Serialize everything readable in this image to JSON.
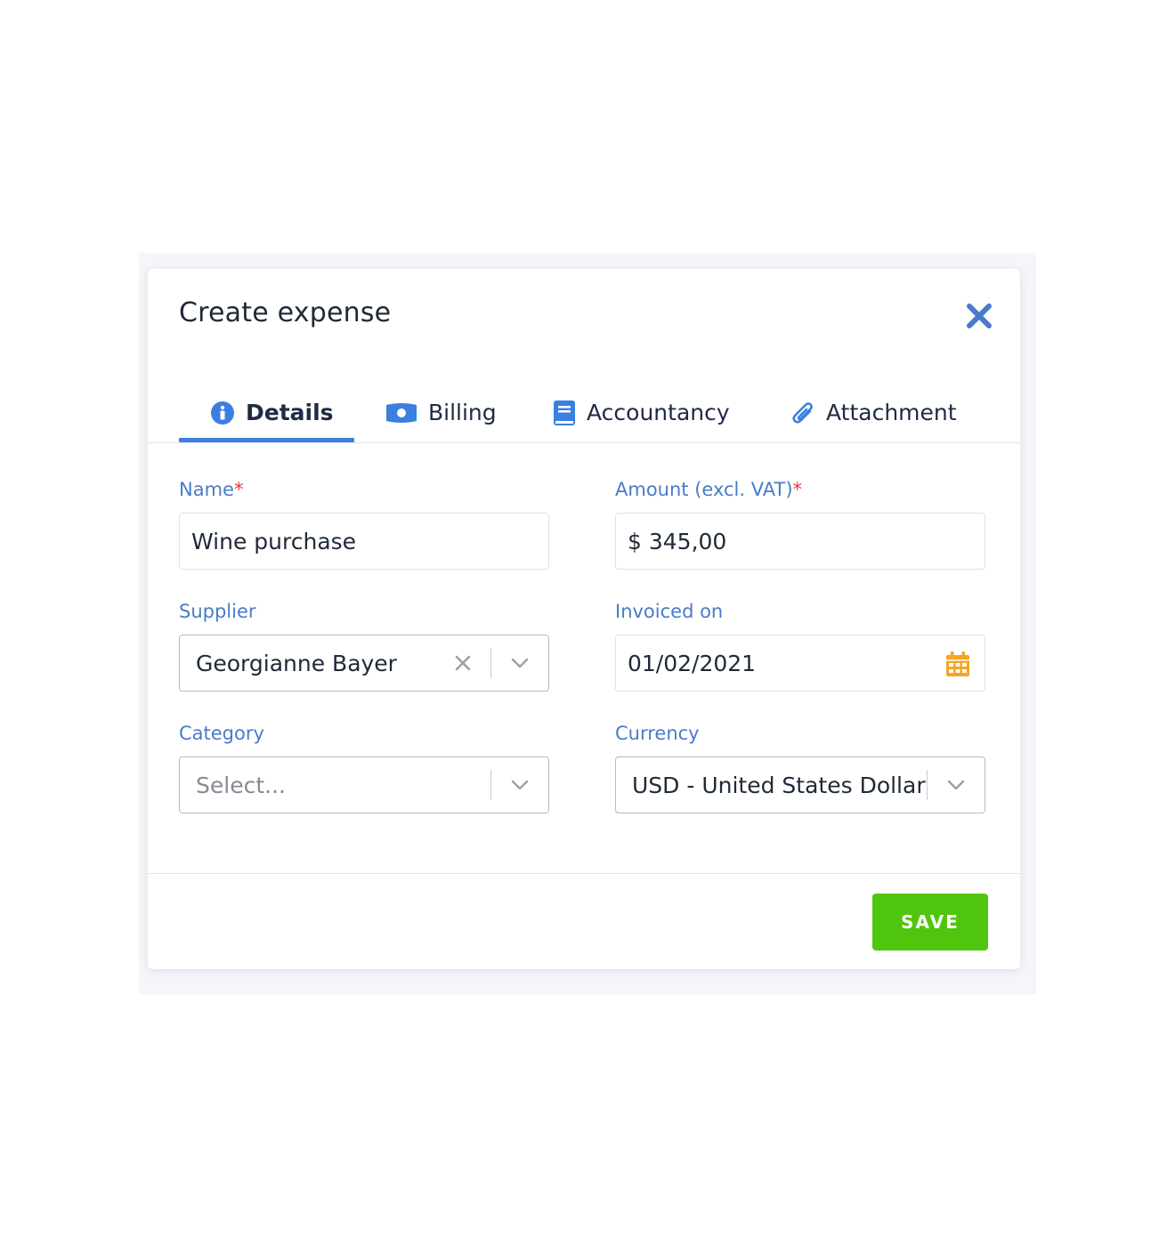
{
  "dialog": {
    "title": "Create expense"
  },
  "tabs": [
    {
      "label": "Details",
      "icon": "info-circle-icon",
      "active": true
    },
    {
      "label": "Billing",
      "icon": "money-bill-icon",
      "active": false
    },
    {
      "label": "Accountancy",
      "icon": "book-icon",
      "active": false
    },
    {
      "label": "Attachment",
      "icon": "paperclip-icon",
      "active": false
    }
  ],
  "form": {
    "name": {
      "label": "Name",
      "required_mark": "*",
      "value": "Wine purchase"
    },
    "amount": {
      "label": "Amount (excl. VAT)",
      "required_mark": "*",
      "value": "$ 345,00"
    },
    "supplier": {
      "label": "Supplier",
      "value": "Georgianne Bayer"
    },
    "invoiced_on": {
      "label": "Invoiced on",
      "value": "01/02/2021"
    },
    "category": {
      "label": "Category",
      "placeholder": "Select..."
    },
    "currency": {
      "label": "Currency",
      "value": "USD - United States Dollar"
    }
  },
  "footer": {
    "save_label": "SAVE"
  },
  "colors": {
    "accent": "#3b7fe0",
    "label": "#4a7bc8",
    "required": "#e53935",
    "save": "#4fc50d",
    "calendar": "#f5a623",
    "close": "#4a7bc8"
  }
}
